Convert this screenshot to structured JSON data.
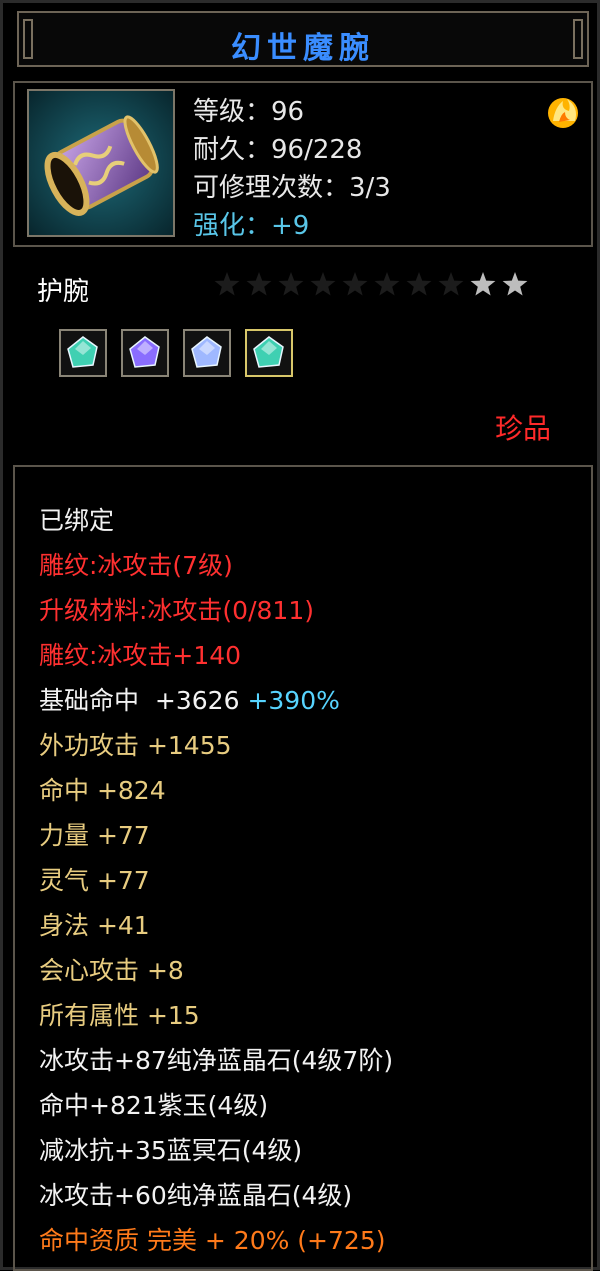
{
  "title": "幻世魔腕",
  "icons": {
    "item": "bracer-icon",
    "element": "fire-element-icon",
    "star": "star-icon",
    "gem": "gem-icon"
  },
  "stats": {
    "level": "等级：96",
    "durability": "耐久：96/228",
    "repairs": "可修理次数：3/3",
    "enhance_label": "强化：",
    "enhance_value": "+9"
  },
  "item_type": "护腕",
  "stars_lit": 2,
  "stars_total": 10,
  "gems": [
    {
      "color": "#3fd0b2"
    },
    {
      "color": "#8a6dff"
    },
    {
      "color": "#9fb8ff"
    },
    {
      "color": "#3fd0b2"
    }
  ],
  "rarity": "珍品",
  "colors": {
    "title": "#3a8dff",
    "red": "#ff3030",
    "gold": "#e8cc80",
    "cyan": "#57d4ff",
    "orange": "#ff7a1a"
  },
  "attributes": {
    "bound": "已绑定",
    "engrave1": "雕纹:冰攻击(7级)",
    "upgrade": "升级材料:冰攻击(0/811)",
    "engrave2": "雕纹:冰攻击+140",
    "base_hit_label": "基础命中",
    "base_hit_value": "+3626",
    "base_hit_bonus": "+390%",
    "attack": "外功攻击  +1455",
    "hit": "命中  +824",
    "strength": "力量  +77",
    "spirit": "灵气  +77",
    "agility": "身法  +41",
    "crit": "会心攻击  +8",
    "all": "所有属性  +15",
    "gem1": "冰攻击+87纯净蓝晶石(4级7阶)",
    "gem2": "命中+821紫玉(4级)",
    "gem3": "减冰抗+35蓝冥石(4级)",
    "gem4": "冰攻击+60纯净蓝晶石(4级)",
    "aptitude": "命中资质  完美  + 20% (+725)"
  }
}
